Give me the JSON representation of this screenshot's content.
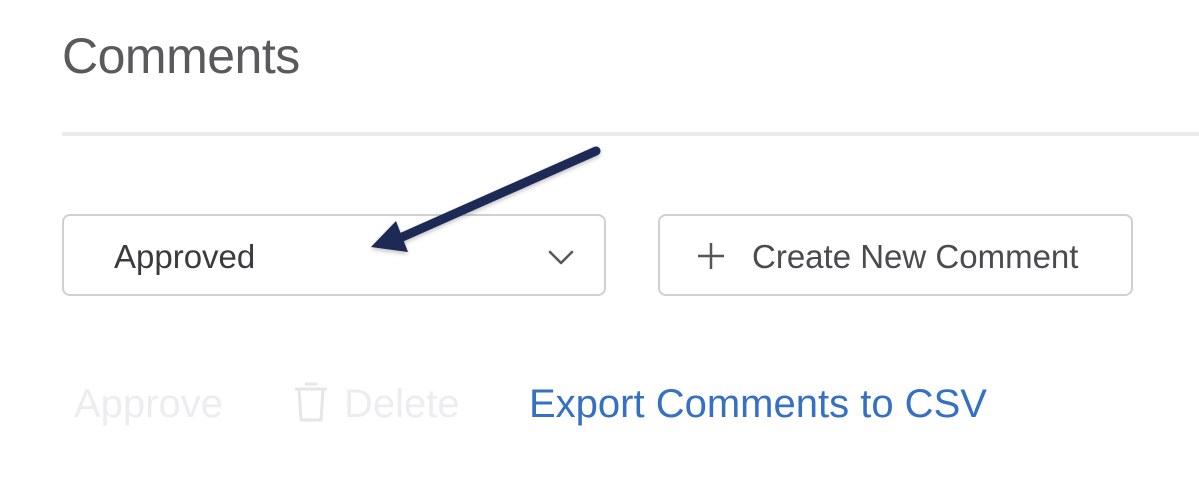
{
  "header": {
    "title": "Comments"
  },
  "filter": {
    "selected": "Approved"
  },
  "toolbar": {
    "create_label": "Create New Comment"
  },
  "actions": {
    "approve_label": "Approve",
    "delete_label": "Delete",
    "export_label": "Export Comments to CSV"
  },
  "colors": {
    "title": "#595a5e",
    "border": "#cfd0d4",
    "link": "#3570c4",
    "disabled": "#ededf0",
    "annotation_arrow": "#1c2a55"
  },
  "icons": [
    "chevron-down-icon",
    "plus-icon",
    "trash-icon",
    "annotation-arrow"
  ]
}
